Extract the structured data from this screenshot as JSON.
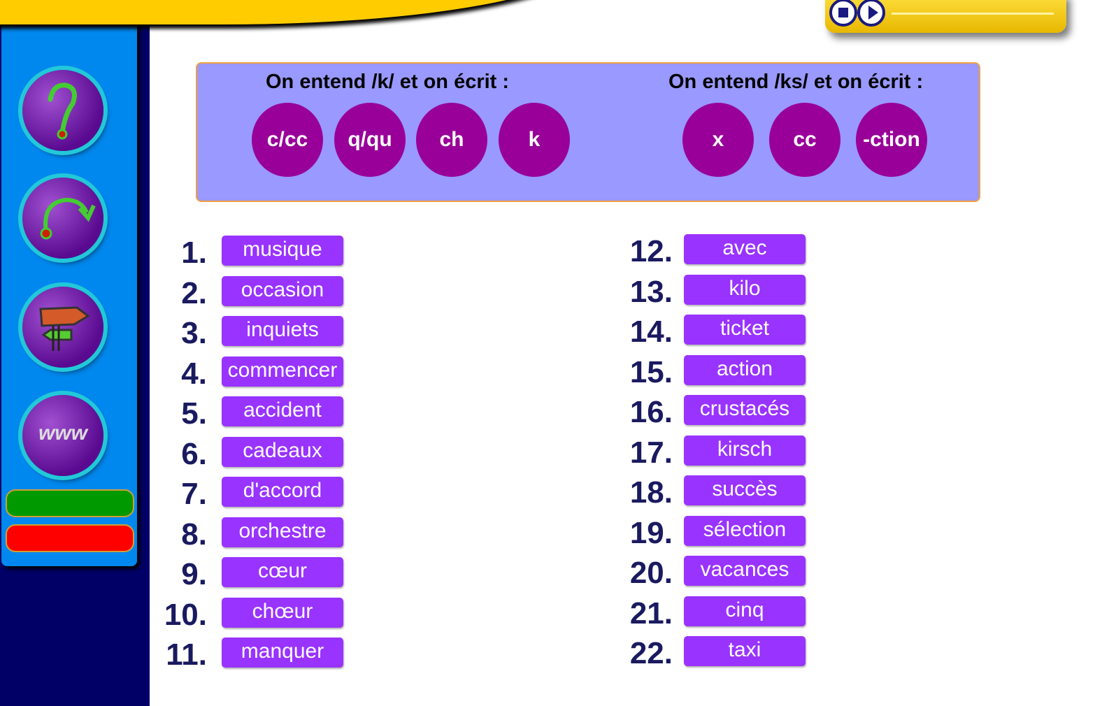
{
  "sidebar": {
    "items": [
      {
        "icon": "help-icon"
      },
      {
        "icon": "restart-arrow-icon"
      },
      {
        "icon": "signpost-icon"
      },
      {
        "icon": "www-icon",
        "label": "www"
      }
    ],
    "colors": {
      "validate": "#009900",
      "cancel": "#ff0000"
    }
  },
  "player": {
    "stop_icon": "stop-icon",
    "play_icon": "play-icon"
  },
  "panel": {
    "k_title": "On entend /k/ et on écrit :",
    "ks_title": "On entend /ks/ et on écrit :",
    "k_options": [
      "c/cc",
      "q/qu",
      "ch",
      "k"
    ],
    "ks_options": [
      "x",
      "cc",
      "-ction"
    ]
  },
  "words_left": [
    {
      "n": "1.",
      "w": "musique"
    },
    {
      "n": "2.",
      "w": "occasion"
    },
    {
      "n": "3.",
      "w": "inquiets"
    },
    {
      "n": "4.",
      "w": "commencer"
    },
    {
      "n": "5.",
      "w": "accident"
    },
    {
      "n": "6.",
      "w": "cadeaux"
    },
    {
      "n": "7.",
      "w": "d'accord"
    },
    {
      "n": "8.",
      "w": "orchestre"
    },
    {
      "n": "9.",
      "w": "cœur"
    },
    {
      "n": "10.",
      "w": "chœur"
    },
    {
      "n": "11.",
      "w": "manquer"
    }
  ],
  "words_right": [
    {
      "n": "12.",
      "w": "avec"
    },
    {
      "n": "13.",
      "w": "kilo"
    },
    {
      "n": "14.",
      "w": "ticket"
    },
    {
      "n": "15.",
      "w": "action"
    },
    {
      "n": "16.",
      "w": "crustacés"
    },
    {
      "n": "17.",
      "w": "kirsch"
    },
    {
      "n": "18.",
      "w": "succès"
    },
    {
      "n": "19.",
      "w": "sélection"
    },
    {
      "n": "20.",
      "w": "vacances"
    },
    {
      "n": "21.",
      "w": "cinq"
    },
    {
      "n": "22.",
      "w": "taxi"
    }
  ]
}
